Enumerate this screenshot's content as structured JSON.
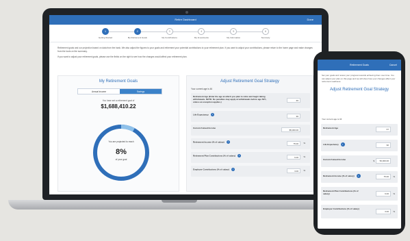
{
  "laptop": {
    "appbar": {
      "title": "Retire Dashboard",
      "action": "Done"
    },
    "steps": [
      {
        "num": "1",
        "label": "Getting Started",
        "done": true
      },
      {
        "num": "2",
        "label": "My Retirement Goals",
        "done": true
      },
      {
        "num": "3",
        "label": "My Contributions",
        "done": false
      },
      {
        "num": "4",
        "label": "My Investments",
        "done": false
      },
      {
        "num": "5",
        "label": "My Information",
        "done": false
      },
      {
        "num": "6",
        "label": "Summary",
        "done": false
      }
    ],
    "intro": [
      "Retirement goals and our projection based on data from the bank. We also adjust the figures to your goals and retirement your potential contributions to your retirement plan. If you want to adjust your contributions, please return to the home page and make changes from the tools on the summary.",
      "If you want to adjust your retirement goals, please use the fields on the right to see how the changes would affect your retirement plan."
    ],
    "left_panel": {
      "title": "My Retirement Goals",
      "toggle": [
        "Annual income",
        "Savings"
      ],
      "projected_label": "You have set a retirement goal of",
      "amount": "$1,688,410.22",
      "ring_line1": "You are projected to reach",
      "percent": "8%",
      "ring_line2": "of your goal",
      "progress": 0.08
    },
    "right_panel": {
      "title": "Adjust Retirement Goal Strategy",
      "current_age": "Your current age is 46",
      "rows": [
        {
          "label": "Retirement Age (Enter the age at which you plan to retire and begin taking withdrawals. NOTE: No penalties may apply at withdrawals before age 59½, unless an exception applies.)",
          "value": "65",
          "unit": ""
        },
        {
          "label": "Life Expectancy",
          "value": "90",
          "unit": "",
          "info": true
        },
        {
          "label": "Current Annual Income",
          "value": "$5,000.00",
          "unit": "",
          "prefix": "$"
        },
        {
          "label": "Retirement Income (% of salary)",
          "value": "75.00",
          "unit": "%",
          "info": true
        },
        {
          "label": "Retirement Plan Contributions (% of salary)",
          "value": "6.00",
          "unit": "%",
          "info": true
        },
        {
          "label": "Employer Contributions (% of salary)",
          "value": "3.00",
          "unit": "%",
          "info": true
        }
      ]
    }
  },
  "phone": {
    "appbar": {
      "title": "Retirement Goals",
      "action": "Cancel"
    },
    "intro": "Set your goals and review your progress towards achieving them over time. You can adjust your plan on this page and we will show how your changes affect your retirement readiness.",
    "title": "Adjust Retirement Goal Strategy",
    "current_age": "Your current age is 46",
    "rows": [
      {
        "label": "Retirement Age",
        "value": "67",
        "unit": ""
      },
      {
        "label": "Life Expectancy",
        "value": "90",
        "unit": "",
        "info": true
      },
      {
        "label": "Current Annual Income",
        "value": "50,000.00",
        "unit": "",
        "prefix": "$"
      },
      {
        "label": "Retirement Income (% of salary)",
        "value": "75.00",
        "unit": "%",
        "info": true
      },
      {
        "label": "Retirement Plan Contributions (% of salary)",
        "value": "6.00",
        "unit": "%",
        "info": true
      },
      {
        "label": "Employer Contributions (% of salary)",
        "value": "3.00",
        "unit": "%",
        "info": true
      }
    ]
  },
  "colors": {
    "accent": "#2f6fb9",
    "ring_track": "#2f6fb9",
    "ring_progress": "#8fc1ea"
  }
}
